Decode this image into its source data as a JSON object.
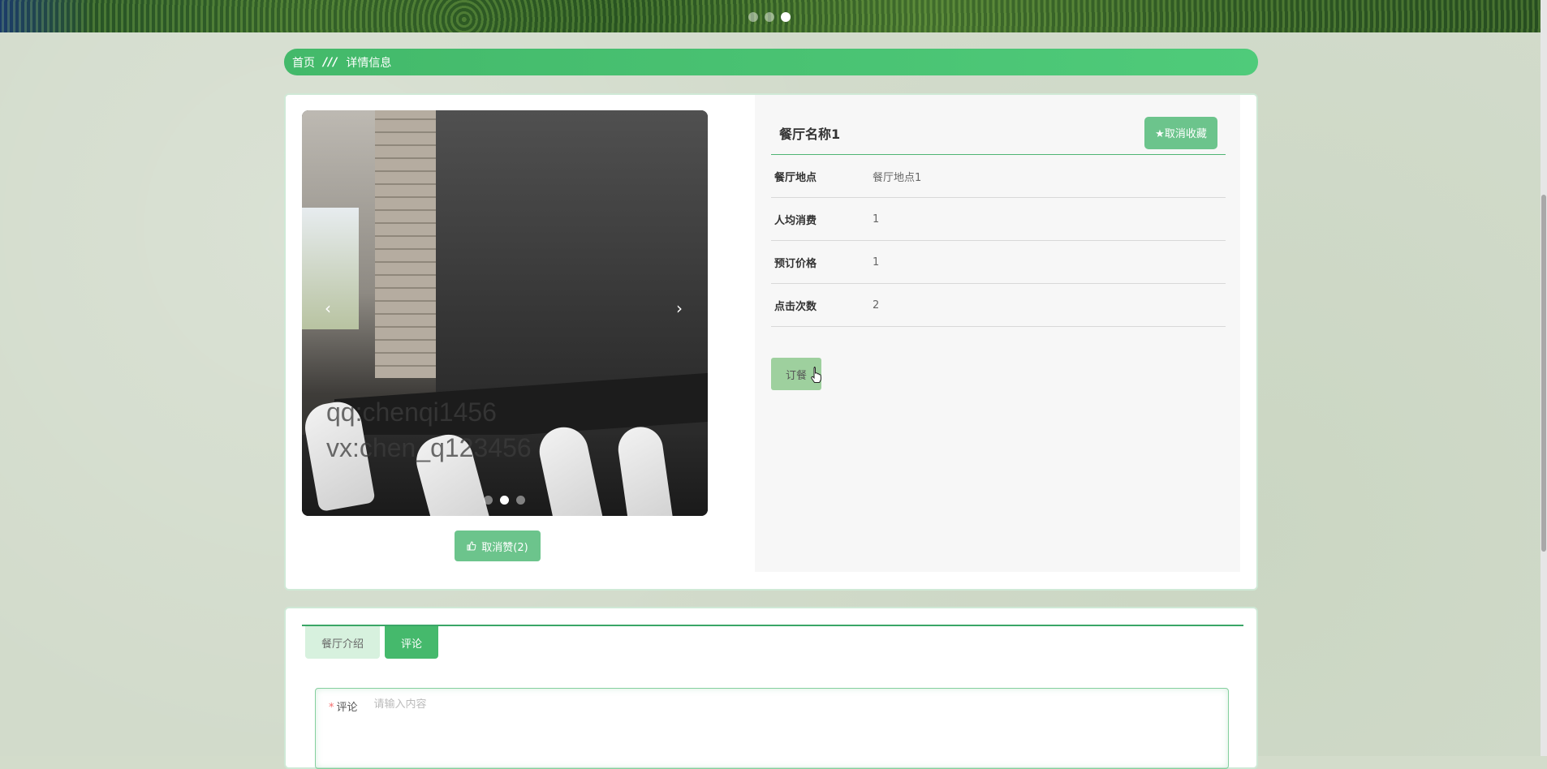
{
  "banner": {
    "slides": 3,
    "active_slide": 3
  },
  "breadcrumb": {
    "home": "首页",
    "separator": "///",
    "current": "详情信息"
  },
  "gallery": {
    "watermark_line1": "qq:chenqi1456",
    "watermark_line2": "vx:chen_q123456",
    "prev_icon": "‹",
    "next_icon": "›",
    "slides": 3,
    "active_slide": 2
  },
  "like_button": {
    "label": "取消赞(2)",
    "icon": "thumbs-up-icon"
  },
  "info": {
    "title": "餐厅名称1",
    "favorite_label": "★取消收藏",
    "rows": [
      {
        "key": "餐厅地点",
        "value": "餐厅地点1"
      },
      {
        "key": "人均消费",
        "value": "1"
      },
      {
        "key": "预订价格",
        "value": "1"
      },
      {
        "key": "点击次数",
        "value": "2"
      }
    ],
    "order_label": "订餐"
  },
  "tabs": [
    {
      "label": "餐厅介绍",
      "active": false
    },
    {
      "label": "评论",
      "active": true
    }
  ],
  "comment": {
    "label": "评论",
    "required_mark": "*",
    "placeholder": "请输入内容"
  },
  "colors": {
    "accent": "#45b96c",
    "button": "#6cc48c",
    "order_button": "#9ed09e"
  }
}
